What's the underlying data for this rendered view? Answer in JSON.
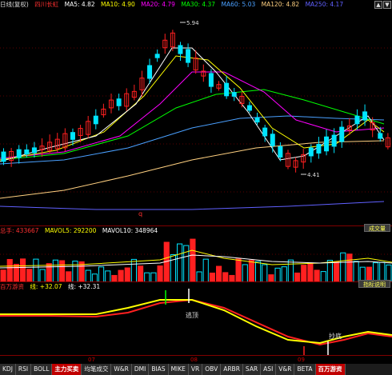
{
  "main": {
    "legend": {
      "period": "日线(复权)",
      "stock": "四川长虹",
      "ma5": "MA5: 4.82",
      "ma10": "MA10: 4.90",
      "ma20": "MA20: 4.79",
      "ma30": "MA30: 4.37",
      "ma60": "MA60: 5.03",
      "ma120": "MA120: 4.82",
      "ma250": "MA250: 4.17"
    },
    "high_label": "5.94",
    "low_label": "4.41",
    "marker": "q",
    "colors": {
      "up": "#00e5ff",
      "down": "#ff2020",
      "ma5": "#ffffff",
      "ma10": "#ffff00",
      "ma20": "#ff00ff",
      "ma30": "#00ff00",
      "ma60": "#4aa0ff",
      "ma120": "#ffd080",
      "ma250": "#6060ff"
    }
  },
  "volume": {
    "legend": {
      "label": "总手: 433667",
      "mavol5": "MAVOL5: 292200",
      "mavol10": "MAVOL10: 348964"
    },
    "button": "成交量"
  },
  "indicator": {
    "legend": {
      "name": "百万游资",
      "line1": "线: +32.07",
      "line2": "线: +32.31"
    },
    "button": "指标说明",
    "label_top": "逃顶",
    "label_bottom": "抄底"
  },
  "x_axis": {
    "labels": [
      "07",
      "08",
      "09"
    ]
  },
  "tabs": [
    "KDJ",
    "RSI",
    "BOLL",
    "主力买卖",
    "均笔成交",
    "W&R",
    "DMI",
    "BIAS",
    "MIKE",
    "VR",
    "OBV",
    "ARBR",
    "SAR",
    "ASI",
    "V&R",
    "BETA",
    "百万游资"
  ],
  "active_tab": "百万游资"
}
